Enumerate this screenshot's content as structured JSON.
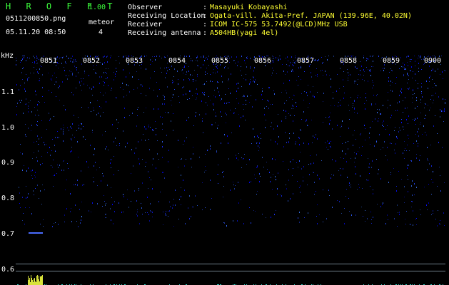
{
  "header": {
    "app_title": "H R O F F T",
    "version": "1.00",
    "filename": "0511200850.png",
    "datetime": "05.11.20 08:50",
    "meteor_label": "meteor",
    "meteor_count": "4"
  },
  "meta": [
    {
      "key": "Observer",
      "value": "Masayuki Kobayashi"
    },
    {
      "key": "Receiving Location",
      "value": "Ogata-vill. Akita-Pref. JAPAN (139.96E, 40.02N)"
    },
    {
      "key": "Receiver",
      "value": "ICOM IC-575 53.7492(@LCD)MHz USB"
    },
    {
      "key": "Receiving antenna",
      "value": "A504HB(yagi 4el)"
    }
  ],
  "axis": {
    "unit": "kHz",
    "y_ticks": [
      "1.1",
      "1.0",
      "0.9",
      "0.8",
      "0.7",
      "0.6"
    ],
    "time_ticks": [
      "0851",
      "0852",
      "0853",
      "0854",
      "0855",
      "0856",
      "0857",
      "0858",
      "0859",
      "0900"
    ]
  },
  "colors": {
    "noise": "#1a3dff",
    "header_green": "#3cff3c",
    "header_yellow": "#ffff33"
  }
}
